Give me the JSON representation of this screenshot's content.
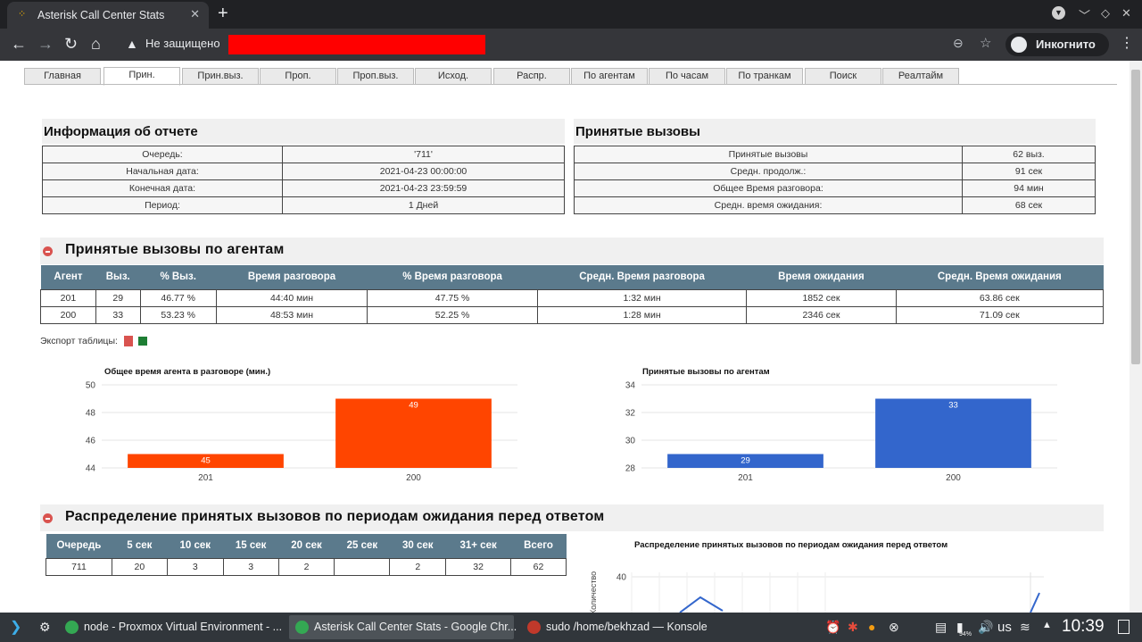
{
  "browser": {
    "tab_title": "Asterisk Call Center Stats",
    "new_tab_symbol": "+",
    "security_text": "Не защищено",
    "incognito_label": "Инкогнито"
  },
  "nav_tabs": [
    "Главная",
    "Прин.",
    "Прин.выз.",
    "Проп.",
    "Проп.выз.",
    "Исход.",
    "Распр.",
    "По агентам",
    "По часам",
    "По транкам",
    "Поиск",
    "Реалтайм"
  ],
  "active_tab": "Прин.",
  "report_info": {
    "title": "Информация об отчете",
    "rows": [
      {
        "label": "Очередь:",
        "value": "'711'"
      },
      {
        "label": "Начальная дата:",
        "value": "2021-04-23 00:00:00"
      },
      {
        "label": "Конечная дата:",
        "value": "2021-04-23 23:59:59"
      },
      {
        "label": "Период:",
        "value": "1 Дней"
      }
    ]
  },
  "answered_summary": {
    "title": "Принятые вызовы",
    "rows": [
      {
        "label": "Принятые вызовы",
        "value": "62 выз."
      },
      {
        "label": "Средн. продолж.:",
        "value": "91 сек"
      },
      {
        "label": "Общее Время разговора:",
        "value": "94 мин"
      },
      {
        "label": "Средн. время ожидания:",
        "value": "68 сек"
      }
    ]
  },
  "agents_section": {
    "title": "Принятые вызовы по агентам",
    "headers": [
      "Агент",
      "Выз.",
      "% Выз.",
      "Время разговора",
      "% Время разговора",
      "Средн. Время разговора",
      "Время ожидания",
      "Средн. Время ожидания"
    ],
    "rows": [
      [
        "201",
        "29",
        "46.77 %",
        "44:40 мин",
        "47.75 %",
        "1:32 мин",
        "1852 сек",
        "63.86 сек"
      ],
      [
        "200",
        "33",
        "53.23 %",
        "48:53 мин",
        "52.25 %",
        "1:28 мин",
        "2346 сек",
        "71.09 сек"
      ]
    ],
    "export_label": "Экспорт таблицы:"
  },
  "chart_data": [
    {
      "type": "bar",
      "title": "Общее время агента в разговоре (мин.)",
      "categories": [
        "201",
        "200"
      ],
      "values": [
        45,
        49
      ],
      "ylim": [
        44,
        50
      ],
      "yticks": [
        44,
        46,
        48,
        50
      ],
      "color": "#ff4500",
      "grid": true
    },
    {
      "type": "bar",
      "title": "Принятые вызовы по агентам",
      "categories": [
        "201",
        "200"
      ],
      "values": [
        29,
        33
      ],
      "ylim": [
        28,
        34
      ],
      "yticks": [
        28,
        30,
        32,
        34
      ],
      "color": "#3366cc",
      "grid": true
    },
    {
      "type": "line",
      "title": "Распределение принятых вызовов по периодам ожидания перед ответом",
      "ylabel": "Количество",
      "ylim_visible": [
        20,
        40
      ],
      "yticks": [
        20,
        40
      ],
      "color": "#3366cc",
      "grid": true
    }
  ],
  "wait_distribution": {
    "title": "Распределение принятых вызовов по периодам ожидания перед ответом",
    "headers": [
      "Очередь",
      "5 сек",
      "10 сек",
      "15 сек",
      "20 сек",
      "25 сек",
      "30 сек",
      "31+ сек",
      "Всего"
    ],
    "row": [
      "711",
      "20",
      "3",
      "3",
      "2",
      "",
      "2",
      "32",
      "62"
    ]
  },
  "taskbar": {
    "tasks": [
      {
        "label": "node - Proxmox Virtual Environment - ..."
      },
      {
        "label": "Asterisk Call Center Stats - Google Chr..."
      },
      {
        "label": "sudo /home/bekhzad — Konsole"
      }
    ],
    "keyboard_layout": "us",
    "battery": "94%",
    "clock": "10:39"
  },
  "colors": {
    "header_bg": "#5b7a8c",
    "section_bg": "#f0f0f0",
    "orange": "#ff4500",
    "blue": "#3366cc"
  }
}
